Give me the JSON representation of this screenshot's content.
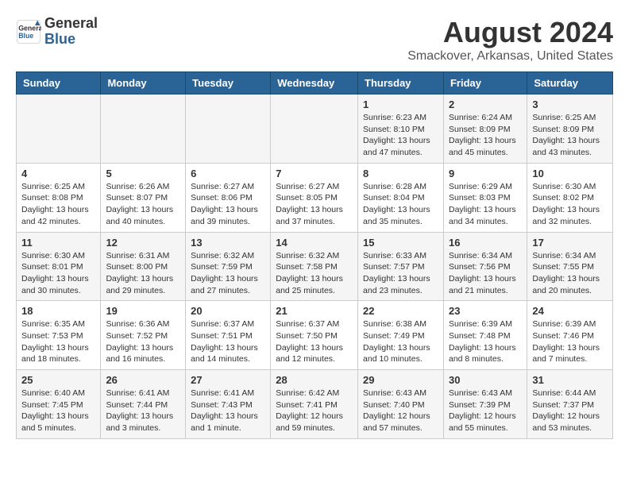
{
  "logo": {
    "general": "General",
    "blue": "Blue"
  },
  "title": "August 2024",
  "location": "Smackover, Arkansas, United States",
  "headers": [
    "Sunday",
    "Monday",
    "Tuesday",
    "Wednesday",
    "Thursday",
    "Friday",
    "Saturday"
  ],
  "weeks": [
    [
      {
        "day": "",
        "info": ""
      },
      {
        "day": "",
        "info": ""
      },
      {
        "day": "",
        "info": ""
      },
      {
        "day": "",
        "info": ""
      },
      {
        "day": "1",
        "info": "Sunrise: 6:23 AM\nSunset: 8:10 PM\nDaylight: 13 hours\nand 47 minutes."
      },
      {
        "day": "2",
        "info": "Sunrise: 6:24 AM\nSunset: 8:09 PM\nDaylight: 13 hours\nand 45 minutes."
      },
      {
        "day": "3",
        "info": "Sunrise: 6:25 AM\nSunset: 8:09 PM\nDaylight: 13 hours\nand 43 minutes."
      }
    ],
    [
      {
        "day": "4",
        "info": "Sunrise: 6:25 AM\nSunset: 8:08 PM\nDaylight: 13 hours\nand 42 minutes."
      },
      {
        "day": "5",
        "info": "Sunrise: 6:26 AM\nSunset: 8:07 PM\nDaylight: 13 hours\nand 40 minutes."
      },
      {
        "day": "6",
        "info": "Sunrise: 6:27 AM\nSunset: 8:06 PM\nDaylight: 13 hours\nand 39 minutes."
      },
      {
        "day": "7",
        "info": "Sunrise: 6:27 AM\nSunset: 8:05 PM\nDaylight: 13 hours\nand 37 minutes."
      },
      {
        "day": "8",
        "info": "Sunrise: 6:28 AM\nSunset: 8:04 PM\nDaylight: 13 hours\nand 35 minutes."
      },
      {
        "day": "9",
        "info": "Sunrise: 6:29 AM\nSunset: 8:03 PM\nDaylight: 13 hours\nand 34 minutes."
      },
      {
        "day": "10",
        "info": "Sunrise: 6:30 AM\nSunset: 8:02 PM\nDaylight: 13 hours\nand 32 minutes."
      }
    ],
    [
      {
        "day": "11",
        "info": "Sunrise: 6:30 AM\nSunset: 8:01 PM\nDaylight: 13 hours\nand 30 minutes."
      },
      {
        "day": "12",
        "info": "Sunrise: 6:31 AM\nSunset: 8:00 PM\nDaylight: 13 hours\nand 29 minutes."
      },
      {
        "day": "13",
        "info": "Sunrise: 6:32 AM\nSunset: 7:59 PM\nDaylight: 13 hours\nand 27 minutes."
      },
      {
        "day": "14",
        "info": "Sunrise: 6:32 AM\nSunset: 7:58 PM\nDaylight: 13 hours\nand 25 minutes."
      },
      {
        "day": "15",
        "info": "Sunrise: 6:33 AM\nSunset: 7:57 PM\nDaylight: 13 hours\nand 23 minutes."
      },
      {
        "day": "16",
        "info": "Sunrise: 6:34 AM\nSunset: 7:56 PM\nDaylight: 13 hours\nand 21 minutes."
      },
      {
        "day": "17",
        "info": "Sunrise: 6:34 AM\nSunset: 7:55 PM\nDaylight: 13 hours\nand 20 minutes."
      }
    ],
    [
      {
        "day": "18",
        "info": "Sunrise: 6:35 AM\nSunset: 7:53 PM\nDaylight: 13 hours\nand 18 minutes."
      },
      {
        "day": "19",
        "info": "Sunrise: 6:36 AM\nSunset: 7:52 PM\nDaylight: 13 hours\nand 16 minutes."
      },
      {
        "day": "20",
        "info": "Sunrise: 6:37 AM\nSunset: 7:51 PM\nDaylight: 13 hours\nand 14 minutes."
      },
      {
        "day": "21",
        "info": "Sunrise: 6:37 AM\nSunset: 7:50 PM\nDaylight: 13 hours\nand 12 minutes."
      },
      {
        "day": "22",
        "info": "Sunrise: 6:38 AM\nSunset: 7:49 PM\nDaylight: 13 hours\nand 10 minutes."
      },
      {
        "day": "23",
        "info": "Sunrise: 6:39 AM\nSunset: 7:48 PM\nDaylight: 13 hours\nand 8 minutes."
      },
      {
        "day": "24",
        "info": "Sunrise: 6:39 AM\nSunset: 7:46 PM\nDaylight: 13 hours\nand 7 minutes."
      }
    ],
    [
      {
        "day": "25",
        "info": "Sunrise: 6:40 AM\nSunset: 7:45 PM\nDaylight: 13 hours\nand 5 minutes."
      },
      {
        "day": "26",
        "info": "Sunrise: 6:41 AM\nSunset: 7:44 PM\nDaylight: 13 hours\nand 3 minutes."
      },
      {
        "day": "27",
        "info": "Sunrise: 6:41 AM\nSunset: 7:43 PM\nDaylight: 13 hours\nand 1 minute."
      },
      {
        "day": "28",
        "info": "Sunrise: 6:42 AM\nSunset: 7:41 PM\nDaylight: 12 hours\nand 59 minutes."
      },
      {
        "day": "29",
        "info": "Sunrise: 6:43 AM\nSunset: 7:40 PM\nDaylight: 12 hours\nand 57 minutes."
      },
      {
        "day": "30",
        "info": "Sunrise: 6:43 AM\nSunset: 7:39 PM\nDaylight: 12 hours\nand 55 minutes."
      },
      {
        "day": "31",
        "info": "Sunrise: 6:44 AM\nSunset: 7:37 PM\nDaylight: 12 hours\nand 53 minutes."
      }
    ]
  ]
}
